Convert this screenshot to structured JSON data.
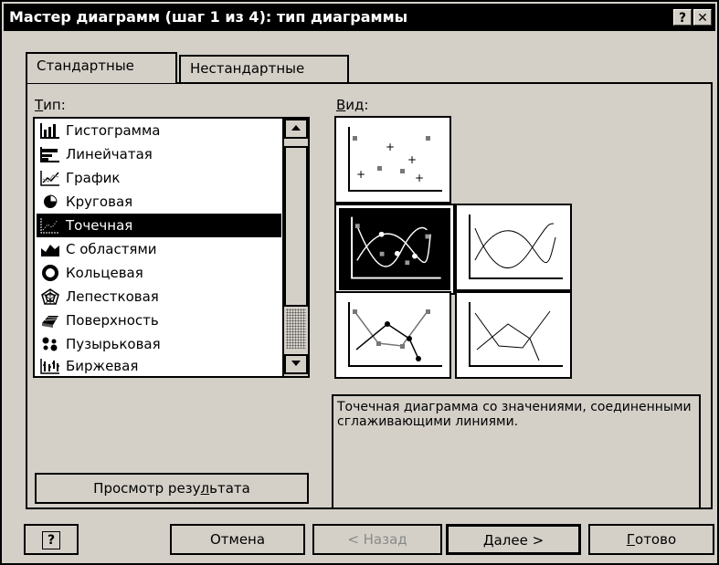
{
  "window": {
    "title": "Мастер диаграмм (шаг 1 из 4): тип диаграммы",
    "help_glyph": "?",
    "close_glyph": "✕"
  },
  "tabs": [
    {
      "label": "Стандартные",
      "active": true
    },
    {
      "label": "Нестандартные",
      "active": false
    }
  ],
  "type_list": {
    "label_first": "Т",
    "label_rest": "ип:",
    "items": [
      {
        "label": "Гистограмма",
        "icon": "column-chart-icon"
      },
      {
        "label": "Линейчатая",
        "icon": "bar-chart-icon"
      },
      {
        "label": "График",
        "icon": "line-chart-icon"
      },
      {
        "label": "Круговая",
        "icon": "pie-chart-icon"
      },
      {
        "label": "Точечная",
        "icon": "scatter-chart-icon",
        "selected": true
      },
      {
        "label": "С областями",
        "icon": "area-chart-icon"
      },
      {
        "label": "Кольцевая",
        "icon": "doughnut-chart-icon"
      },
      {
        "label": "Лепестковая",
        "icon": "radar-chart-icon"
      },
      {
        "label": "Поверхность",
        "icon": "surface-chart-icon"
      },
      {
        "label": "Пузырьковая",
        "icon": "bubble-chart-icon"
      },
      {
        "label": "Биржевая",
        "icon": "stock-chart-icon"
      }
    ]
  },
  "view": {
    "label_first": "В",
    "label_rest": "ид:"
  },
  "description": "Точечная диаграмма со значениями, соединенными сглаживающими линиями.",
  "preview_button": {
    "before": "Просмотр резу",
    "u": "л",
    "after": "ьтата"
  },
  "buttons": {
    "help": "?",
    "cancel": "Отмена",
    "back": "< Назад",
    "next": "Далее >",
    "finish_u": "Г",
    "finish_rest": "отово"
  }
}
